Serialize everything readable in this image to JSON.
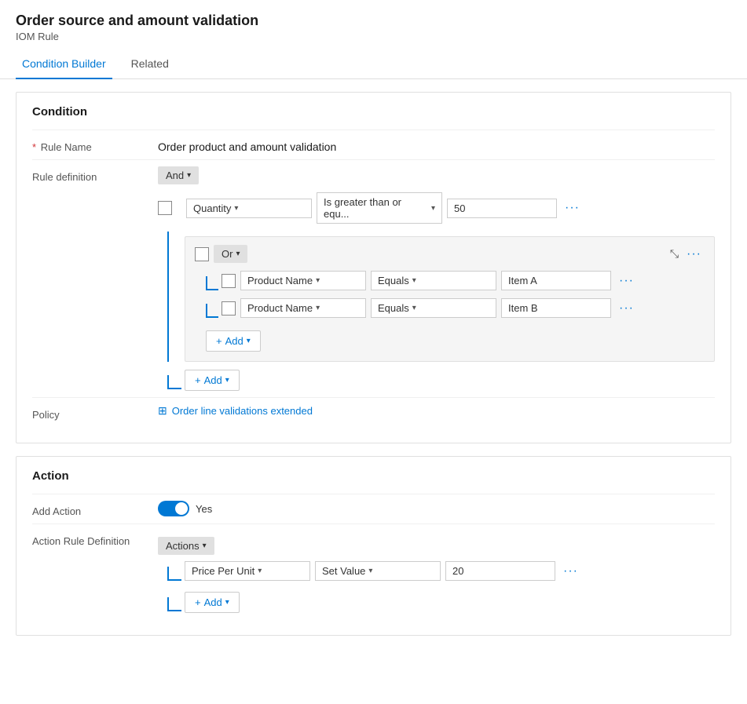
{
  "header": {
    "title": "Order source and amount validation",
    "subtitle": "IOM Rule"
  },
  "tabs": [
    {
      "label": "Condition Builder",
      "active": true
    },
    {
      "label": "Related",
      "active": false
    }
  ],
  "condition_section": {
    "title": "Condition",
    "rule_name_label": "Rule Name",
    "rule_name_required": true,
    "rule_name_value": "Order product and amount validation",
    "rule_definition_label": "Rule definition",
    "and_label": "And",
    "quantity_row": {
      "field": "Quantity",
      "operator": "Is greater than or equ...",
      "value": "50"
    },
    "or_group": {
      "operator_label": "Or",
      "rows": [
        {
          "field": "Product Name",
          "operator": "Equals",
          "value": "Item A"
        },
        {
          "field": "Product Name",
          "operator": "Equals",
          "value": "Item B"
        }
      ],
      "add_label": "Add"
    },
    "add_label": "Add",
    "policy_label": "Policy",
    "policy_link_text": "Order line validations extended"
  },
  "action_section": {
    "title": "Action",
    "add_action_label": "Add Action",
    "toggle_value": "Yes",
    "action_rule_label": "Action Rule Definition",
    "actions_label": "Actions",
    "action_row": {
      "field": "Price Per Unit",
      "operator": "Set Value",
      "value": "20"
    },
    "add_label": "Add"
  },
  "icons": {
    "chevron_down": "▾",
    "expand_collapse": "⤡",
    "more": "···",
    "plus": "+",
    "policy": "⊞"
  }
}
